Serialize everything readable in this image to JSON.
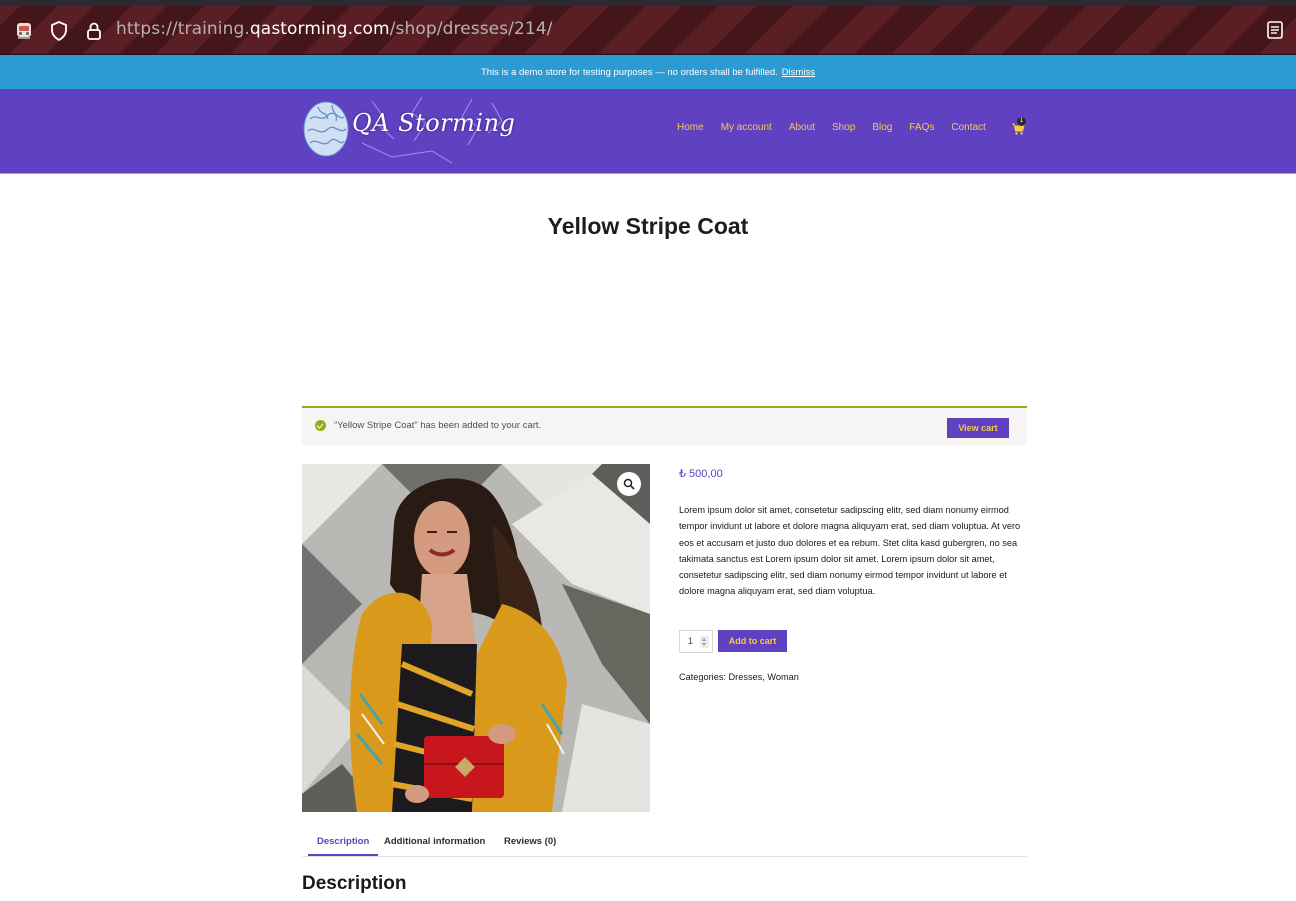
{
  "browser": {
    "url_prefix": "https://training.",
    "url_domain": "qastorming.com",
    "url_path": "/shop/dresses/214/"
  },
  "notice": {
    "text": "This is a demo store for testing purposes — no orders shall be fulfilled.",
    "dismiss": "Dismiss"
  },
  "header": {
    "logo_text": "QA Storming",
    "nav": [
      "Home",
      "My account",
      "About",
      "Shop",
      "Blog",
      "FAQs",
      "Contact"
    ],
    "cart_count": "1"
  },
  "product": {
    "title": "Yellow Stripe Coat",
    "price": "₺ 500,00",
    "description": "Lorem ipsum dolor sit amet, consetetur sadipscing elitr, sed diam nonumy eirmod tempor invidunt ut labore et dolore magna aliquyam erat, sed diam voluptua. At vero eos et accusam et justo duo dolores et ea rebum. Stet clita kasd gubergren, no sea takimata sanctus est Lorem ipsum dolor sit amet. Lorem ipsum dolor sit amet, consetetur sadipscing elitr, sed diam nonumy eirmod tempor invidunt ut labore et dolore magna aliquyam erat, sed diam voluptua.",
    "quantity": "1",
    "add_to_cart": "Add to cart",
    "categories_label": "Categories:",
    "categories": [
      "Dresses",
      "Woman"
    ]
  },
  "message": {
    "text": "“Yellow Stripe Coat” has been added to your cart.",
    "view_cart": "View cart"
  },
  "tabs": [
    "Description",
    "Additional information",
    "Reviews (0)"
  ],
  "section_heading": "Description",
  "colors": {
    "brand": "#6041c1",
    "accent": "#f7c948",
    "notice": "#2c9bd4",
    "success": "#8fae1b"
  }
}
